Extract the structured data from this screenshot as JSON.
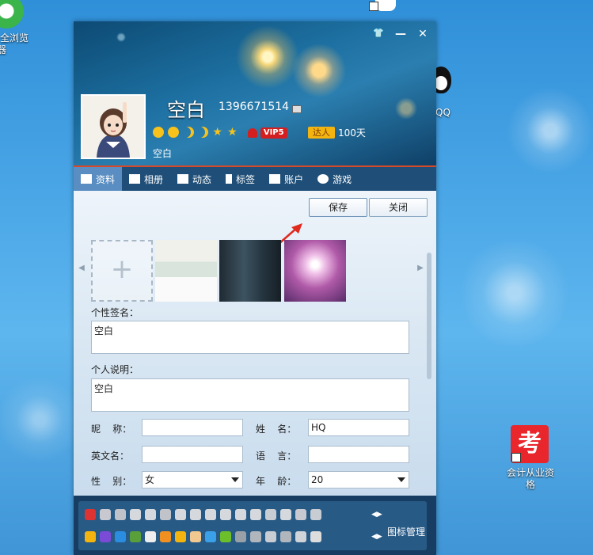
{
  "desktop": {
    "icon_ie_label_line1": "全浏览",
    "icon_ie_label_line2": "器",
    "icon_qq_label": "QQ",
    "icon_exam_glyph": "考",
    "icon_exam_label_line1": "会计从业资",
    "icon_exam_label_line2": "格"
  },
  "window": {
    "controls": {
      "skin": "👕",
      "minimize": "—",
      "close": "✕"
    },
    "profile": {
      "nickname": "空白",
      "qq_number": "1396671514",
      "vip_label": "VIP5",
      "daren_label": "达人",
      "days": "100天",
      "status": "空白"
    },
    "tabs": [
      {
        "label": "资料",
        "icon": "profile-card-icon"
      },
      {
        "label": "相册",
        "icon": "photo-album-icon"
      },
      {
        "label": "动态",
        "icon": "feed-list-icon"
      },
      {
        "label": "标签",
        "icon": "bookmark-tag-icon"
      },
      {
        "label": "账户",
        "icon": "wallet-icon"
      },
      {
        "label": "游戏",
        "icon": "game-icon"
      }
    ],
    "buttons": {
      "save": "保存",
      "close": "关闭"
    },
    "photo_strip": {
      "add": "+",
      "prev": "◀",
      "next": "▶"
    },
    "form": {
      "signature_label": "个性签名：",
      "signature_value": "空白",
      "description_label": "个人说明：",
      "description_value": "空白",
      "nickname_label": "昵    称：",
      "nickname_value": "",
      "name_label": "姓    名：",
      "name_value": "HQ",
      "english_name_label": "英文名：",
      "english_name_value": "",
      "language_label": "语    言：",
      "language_value": "",
      "gender_label": "性    别：",
      "gender_value": "女",
      "age_label": "年    龄：",
      "age_value": "20"
    },
    "icon_manager_label": "图标管理",
    "colors": {
      "accent_red": "#d64a2a",
      "tab_active": "#5a8ec2",
      "vip_red": "#d31f1f"
    }
  }
}
